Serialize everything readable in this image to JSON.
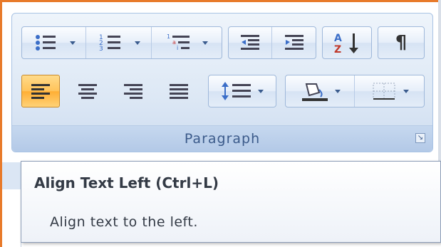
{
  "ribbon": {
    "group_label": "Paragraph",
    "buttons": [
      {
        "name": "bullets",
        "icon": "bulleted-list-icon",
        "has_dropdown": true
      },
      {
        "name": "numbering",
        "icon": "numbered-list-icon",
        "has_dropdown": true
      },
      {
        "name": "multilevel-list",
        "icon": "multilevel-list-icon",
        "has_dropdown": true
      },
      {
        "name": "decrease-indent",
        "icon": "decrease-indent-icon"
      },
      {
        "name": "increase-indent",
        "icon": "increase-indent-icon"
      },
      {
        "name": "sort",
        "icon": "sort-az-icon"
      },
      {
        "name": "show-hide",
        "icon": "pilcrow-icon"
      },
      {
        "name": "align-left",
        "icon": "align-left-icon",
        "active": true
      },
      {
        "name": "center",
        "icon": "align-center-icon"
      },
      {
        "name": "align-right",
        "icon": "align-right-icon"
      },
      {
        "name": "justify",
        "icon": "justify-icon"
      },
      {
        "name": "line-spacing",
        "icon": "line-spacing-icon",
        "has_dropdown": true
      },
      {
        "name": "shading",
        "icon": "paint-bucket-icon",
        "has_dropdown": true
      },
      {
        "name": "borders",
        "icon": "borders-icon",
        "has_dropdown": true
      }
    ],
    "sort_glyph_a": "A",
    "sort_glyph_z": "Z",
    "pilcrow": "¶"
  },
  "tooltip": {
    "title": "Align Text Left (Ctrl+L)",
    "description": "Align text to the left."
  },
  "colors": {
    "frame": "#e87a2a",
    "active_button": "#ffc35a",
    "label_text": "#3b5a8a"
  }
}
